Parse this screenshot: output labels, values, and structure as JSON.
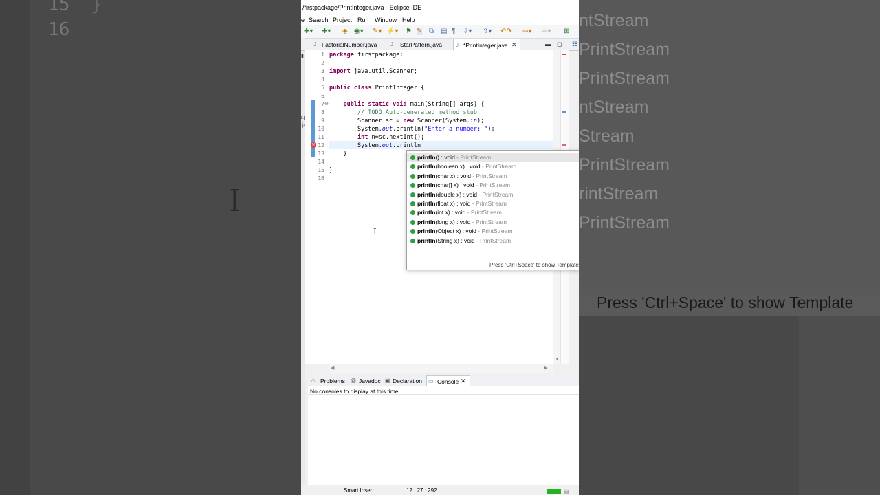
{
  "window": {
    "title": "/firstpackage/PrintInteger.java - Eclipse IDE"
  },
  "menu": [
    "e",
    "Search",
    "Project",
    "Run",
    "Window",
    "Help"
  ],
  "editor_tabs": [
    {
      "label": "FactorialNumber.java",
      "active": false
    },
    {
      "label": "StarPattern.java",
      "active": false
    },
    {
      "label": "*PrintInteger.java",
      "active": true
    }
  ],
  "editor": {
    "line_numbers": [
      "1",
      "2",
      "3",
      "4",
      "5",
      "6",
      "7",
      "8",
      "9",
      "10",
      "11",
      "12",
      "13",
      "14",
      "15",
      "16"
    ],
    "cursor_line": 12,
    "lines": [
      "package firstpackage;",
      "",
      "import java.util.Scanner;",
      "",
      "public class PrintInteger {",
      "",
      "    public static void main(String[] args) {",
      "        // TODO Auto-generated method stub",
      "        Scanner sc = new Scanner(System.in);",
      "        System.out.println(\"Enter a number: \");",
      "        int n=sc.nextInt();",
      "        System.out.println",
      "    }",
      "",
      "}",
      ""
    ]
  },
  "content_assist": {
    "items": [
      {
        "name": "println",
        "sig": "() : void",
        "cls": " - PrintStream",
        "selected": true
      },
      {
        "name": "println",
        "sig": "(boolean x) : void",
        "cls": " - PrintStream",
        "selected": false
      },
      {
        "name": "println",
        "sig": "(char x) : void",
        "cls": " - PrintStream",
        "selected": false
      },
      {
        "name": "println",
        "sig": "(char[] x) : void",
        "cls": " - PrintStream",
        "selected": false
      },
      {
        "name": "println",
        "sig": "(double x) : void",
        "cls": " - PrintStream",
        "selected": false
      },
      {
        "name": "println",
        "sig": "(float x) : void",
        "cls": " - PrintStream",
        "selected": false
      },
      {
        "name": "println",
        "sig": "(int x) : void",
        "cls": " - PrintStream",
        "selected": false
      },
      {
        "name": "println",
        "sig": "(long x) : void",
        "cls": " - PrintStream",
        "selected": false
      },
      {
        "name": "println",
        "sig": "(Object x) : void",
        "cls": " - PrintStream",
        "selected": false
      },
      {
        "name": "println",
        "sig": "(String x) : void",
        "cls": " - PrintStream",
        "selected": false
      }
    ],
    "tip": "Press 'Ctrl+Space' to show Template"
  },
  "bottom_tabs": [
    {
      "label": "Problems",
      "icon": "problems-icon",
      "active": false
    },
    {
      "label": "Javadoc",
      "icon": "javadoc-icon",
      "active": false
    },
    {
      "label": "Declaration",
      "icon": "declaration-icon",
      "active": false
    },
    {
      "label": "Console",
      "icon": "console-icon",
      "active": true
    }
  ],
  "console": {
    "message": "No consoles to display at this time."
  },
  "status": {
    "insert_mode": "Smart Insert",
    "position": "12 : 27 : 292"
  },
  "background": {
    "left_line_numbers": [
      "15",
      "16"
    ],
    "left_brace": "}",
    "right_items": [
      "ntStream",
      "PrintStream",
      "PrintStream",
      "ntStream",
      "Stream",
      "PrintStream",
      "rintStream",
      "PrintStream"
    ],
    "right_tip": "Press 'Ctrl+Space' to show Template"
  },
  "colors": {
    "keyword": "#7f0055",
    "comment": "#3f7f5f",
    "string": "#2a00ff",
    "field": "#0000c0",
    "method_dot": "#2ea043"
  }
}
